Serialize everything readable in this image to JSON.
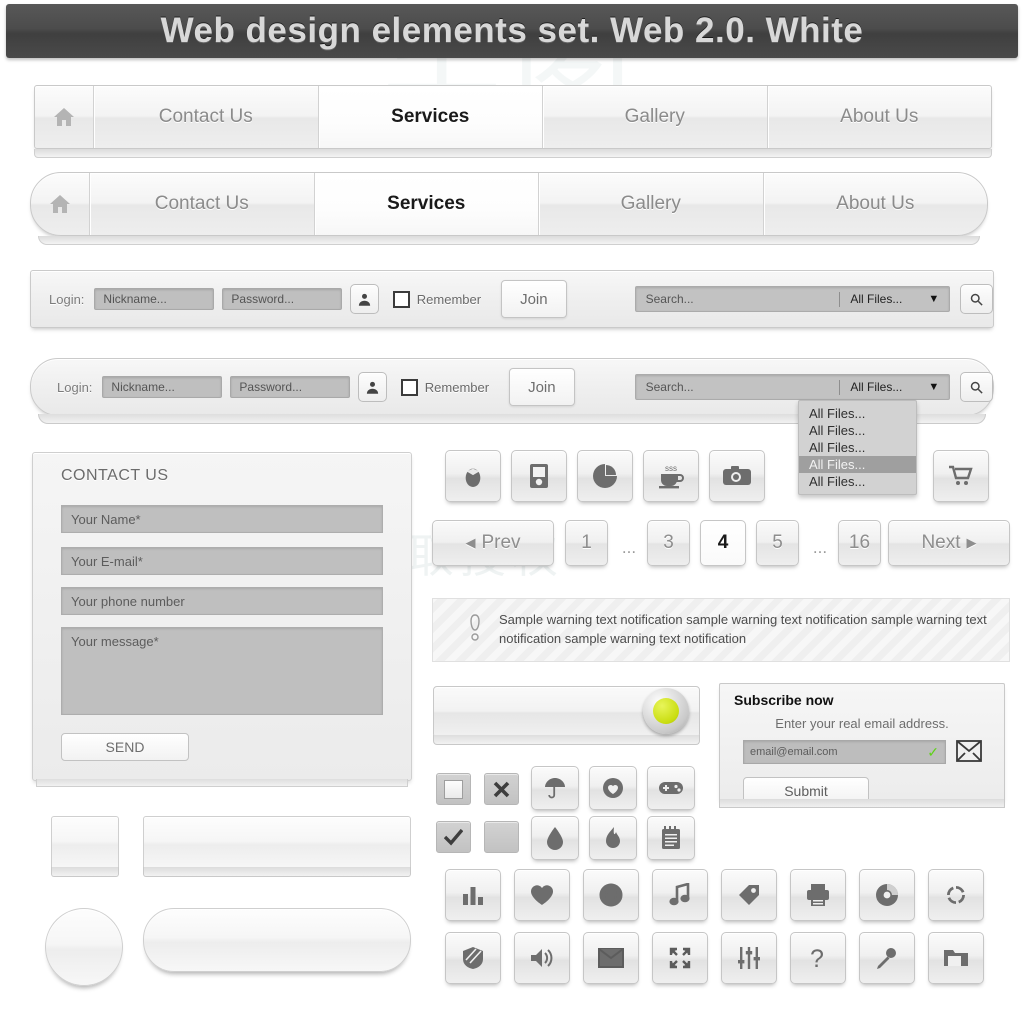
{
  "header": {
    "title": "Web design elements set. Web 2.0. White"
  },
  "watermark": {
    "mark": "千图",
    "line": "商用请获取授权"
  },
  "nav_square": {
    "home_icon": "home-icon",
    "items": [
      {
        "label": "Contact Us",
        "active": false
      },
      {
        "label": "Services",
        "active": true
      },
      {
        "label": "Gallery",
        "active": false
      },
      {
        "label": "About Us",
        "active": false
      }
    ]
  },
  "nav_rounded": {
    "home_icon": "home-icon",
    "items": [
      {
        "label": "Contact Us",
        "active": false
      },
      {
        "label": "Services",
        "active": true
      },
      {
        "label": "Gallery",
        "active": false
      },
      {
        "label": "About Us",
        "active": false
      }
    ]
  },
  "login_bar": {
    "login_label": "Login:",
    "nickname_placeholder": "Nickname...",
    "password_placeholder": "Password...",
    "user_icon": "user-icon",
    "remember_label": "Remember",
    "remember_checked": false,
    "join_label": "Join",
    "search_placeholder": "Search...",
    "filter_value": "All Files...",
    "caret_icon": "caret-down-icon",
    "search_icon": "search-icon"
  },
  "dropdown": {
    "options": [
      "All Files...",
      "All Files...",
      "All Files...",
      "All Files...",
      "All Files..."
    ],
    "selected_index": 3
  },
  "contact_form": {
    "title": "CONTACT US",
    "name_placeholder": "Your Name*",
    "email_placeholder": "Your E-mail*",
    "phone_placeholder": "Your phone number",
    "message_placeholder": "Your message*",
    "send_label": "SEND"
  },
  "app_icons_row": [
    {
      "name": "mouse-icon"
    },
    {
      "name": "mp3-player-icon"
    },
    {
      "name": "pie-chart-icon"
    },
    {
      "name": "coffee-cup-icon"
    },
    {
      "name": "camera-icon"
    },
    {
      "name": "shopping-cart-icon"
    }
  ],
  "pagination": {
    "prev_label": "Prev",
    "next_label": "Next",
    "prev_icon": "arrow-left-icon",
    "next_icon": "arrow-right-icon",
    "ellipsis": "...",
    "pages": [
      "1",
      "3",
      "4",
      "5",
      "16"
    ],
    "active_page": "4"
  },
  "warning": {
    "icon": "exclamation-icon",
    "text": "Sample warning text notification sample warning text notification sample warning text notification sample warning text notification"
  },
  "slider": {
    "knob_color": "#c9dd10",
    "knob_icon": "slider-knob"
  },
  "subscribe": {
    "title": "Subscribe now",
    "hint": "Enter your real email address.",
    "email_placeholder": "email@email.com",
    "valid_icon": "check-icon",
    "valid_color": "#5fd218",
    "mail_icon": "envelope-icon",
    "submit_label": "Submit"
  },
  "checkbox_tiles": [
    {
      "name": "checkbox-empty",
      "state": "empty"
    },
    {
      "name": "checkbox-cross",
      "state": "cross"
    },
    {
      "name": "checkbox-check",
      "state": "check"
    },
    {
      "name": "checkbox-filled",
      "state": "filled"
    }
  ],
  "icon_grid": {
    "row1": [
      "umbrella-icon",
      "heart-circle-icon",
      "gamepad-icon"
    ],
    "row2": [
      "droplet-icon",
      "flame-icon",
      "notepad-icon"
    ],
    "row3": [
      "bar-chart-icon",
      "heart-icon",
      "globe-icon",
      "music-note-icon",
      "tag-icon",
      "printer-icon",
      "disc-icon",
      "refresh-icon"
    ],
    "row4": [
      "shield-icon",
      "speaker-icon",
      "envelope-icon",
      "expand-icon",
      "sliders-icon",
      "question-icon",
      "microphone-icon",
      "folder-icon"
    ]
  },
  "blank_buttons": [
    "square-button",
    "wide-button",
    "circle-button",
    "pill-button"
  ]
}
